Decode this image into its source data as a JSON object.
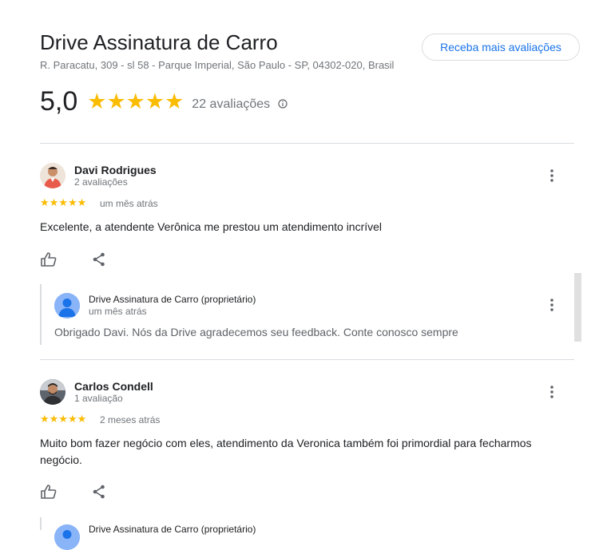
{
  "business": {
    "title": "Drive Assinatura de Carro",
    "address": "R. Paracatu, 309 - sl 58 - Parque Imperial, São Paulo - SP, 04302-020, Brasil",
    "more_reviews_button": "Receba mais avaliações",
    "rating": "5,0",
    "stars": "★★★★★",
    "review_count": "22 avaliações",
    "star_color": "#fbbc04"
  },
  "reviews": [
    {
      "author": "Davi Rodrigues",
      "author_reviews": "2 avaliações",
      "stars": "★★★★★",
      "date": "um mês atrás",
      "text": "Excelente, a atendente Verônica me prestou um atendimento incrível",
      "reply": {
        "owner": "Drive Assinatura de Carro (proprietário)",
        "date": "um mês atrás",
        "text": "Obrigado Davi. Nós da Drive agradecemos seu feedback. Conte conosco sempre"
      }
    },
    {
      "author": "Carlos Condell",
      "author_reviews": "1 avaliação",
      "stars": "★★★★★",
      "date": "2 meses atrás",
      "text": "Muito bom fazer negócio com eles, atendimento da Veronica também foi primordial para fecharmos negócio.",
      "reply": {
        "owner": "Drive Assinatura de Carro (proprietário)"
      }
    }
  ]
}
